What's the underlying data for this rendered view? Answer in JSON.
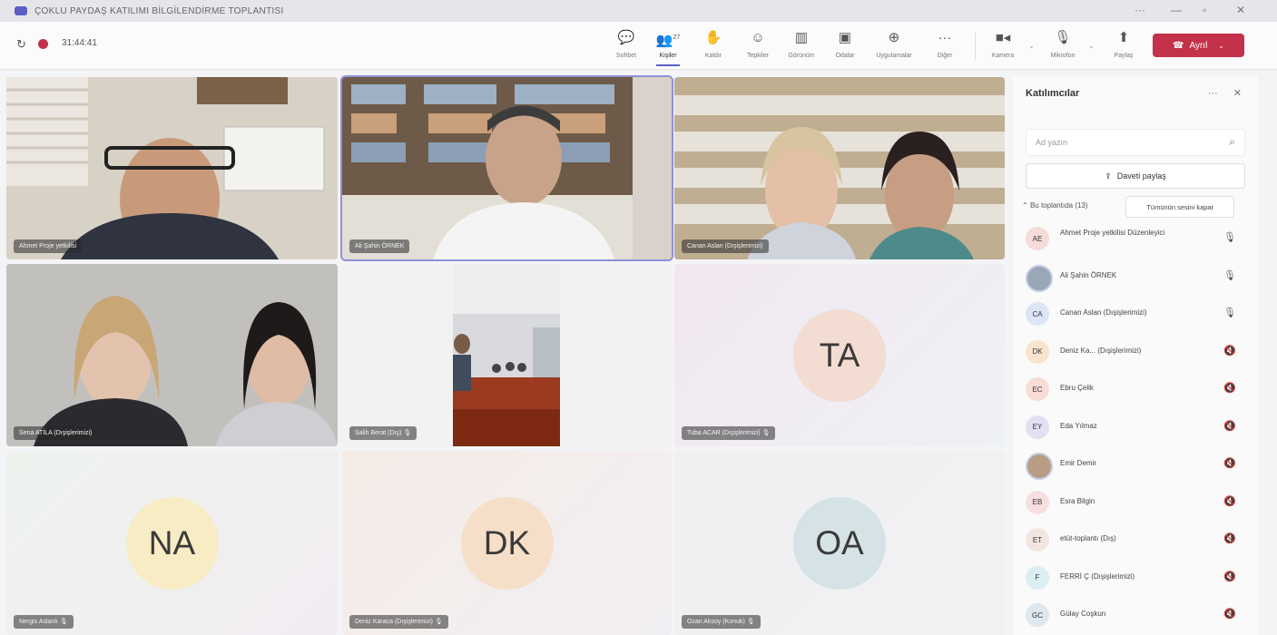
{
  "window": {
    "title": "ÇOKLU PAYDAŞ KATILIMI BİLGİLENDİRME TOPLANTISI"
  },
  "toolbar": {
    "timer": "31:44:41",
    "buttons": [
      {
        "label": "Sohbet",
        "icon": "chat-icon"
      },
      {
        "label": "Kişiler",
        "icon": "people-icon",
        "badge": "27"
      },
      {
        "label": "Kaldır",
        "icon": "raise-hand-icon"
      },
      {
        "label": "Tepkiler",
        "icon": "reactions-icon"
      },
      {
        "label": "Görünüm",
        "icon": "view-icon"
      },
      {
        "label": "Odalar",
        "icon": "rooms-icon"
      },
      {
        "label": "Uygulamalar",
        "icon": "apps-icon"
      },
      {
        "label": "Diğer",
        "icon": "more-icon"
      },
      {
        "label": "Kamera",
        "icon": "camera-icon"
      },
      {
        "label": "Mikrofon",
        "icon": "mic-icon"
      },
      {
        "label": "Paylaş",
        "icon": "share-icon"
      }
    ],
    "leave_label": "Ayrıl"
  },
  "tiles": [
    {
      "name": "Ahmet Proje yetkilisi",
      "kind": "video"
    },
    {
      "name": "Ali Şahin ÖRNEK",
      "kind": "video"
    },
    {
      "name": "Canan Aslan (Dışişlerimizi)",
      "kind": "video"
    },
    {
      "name": "Sena ATİLA (Dışişlerimizi)",
      "kind": "video"
    },
    {
      "name": "Salih Berat (Dış)",
      "kind": "video"
    },
    {
      "name": "Tuba ACAR (Dışişlerimizi)",
      "kind": "avatar",
      "initials": "TA",
      "color": "#f3dcd1"
    },
    {
      "name": "Nergis Aslanlı",
      "kind": "avatar",
      "initials": "NA",
      "color": "#f7ecc4"
    },
    {
      "name": "Deniz Karaca (Dışişlerimizi)",
      "kind": "avatar",
      "initials": "DK",
      "color": "#f6dfc9"
    },
    {
      "name": "Ozan Aksoy (Konuk)",
      "kind": "avatar",
      "initials": "OA",
      "color": "#d5e3e6"
    }
  ],
  "panel": {
    "title": "Katılımcılar",
    "search_placeholder": "Ad yazın",
    "share_invite": "Daveti paylaş",
    "section_label": "Bu toplantıda (13)",
    "mute_all": "Tümünün sesini kapat",
    "participants": [
      {
        "initials": "AE",
        "name": "Ahmet Proje yetkilisi Düzenleyici",
        "color": "#f6dcd8",
        "mic": "on"
      },
      {
        "initials": "",
        "name": "Ali Şahin ÖRNEK",
        "color": "#9aa7b5",
        "mic": "on",
        "photo": true
      },
      {
        "initials": "CA",
        "name": "Canan Aslan (Dışişlerimizi)",
        "color": "#dde6f6",
        "mic": "on"
      },
      {
        "initials": "DK",
        "name": "Deniz Ka... (Dışişlerimizi)",
        "color": "#f9e3cc",
        "mic": "muted"
      },
      {
        "initials": "EC",
        "name": "Ebru Çelik",
        "color": "#f8dcd6",
        "mic": "muted"
      },
      {
        "initials": "EY",
        "name": "Eda Yılmaz",
        "color": "#e2e0f3",
        "mic": "muted"
      },
      {
        "initials": "",
        "name": "Emir Demir",
        "color": "#b89c84",
        "mic": "muted",
        "photo": true
      },
      {
        "initials": "EB",
        "name": "Esra Bilgin",
        "color": "#f7dfe1",
        "mic": "muted"
      },
      {
        "initials": "ET",
        "name": "etüt-toplantı (Dış)",
        "color": "#f3e6e1",
        "mic": "muted"
      },
      {
        "initials": "F",
        "name": "FERRİ Ç (Dışişlerimizi)",
        "color": "#dbeef2",
        "mic": "muted"
      },
      {
        "initials": "GC",
        "name": "Gülay Coşkun",
        "color": "#dfe7ef",
        "mic": "muted"
      }
    ]
  }
}
